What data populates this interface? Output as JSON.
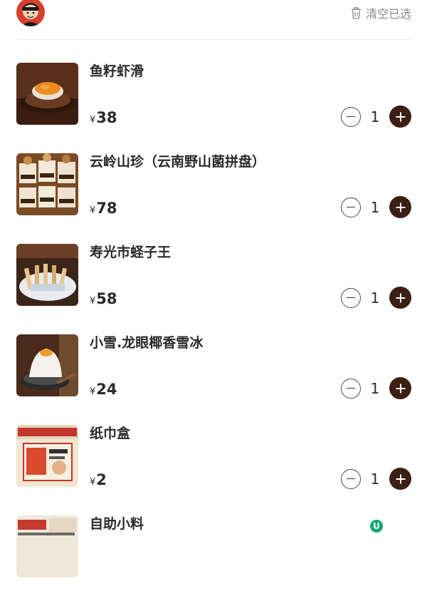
{
  "header": {
    "clear_label": "清空已选"
  },
  "items": [
    {
      "name": "鱼籽虾滑",
      "currency": "¥",
      "price": "38",
      "qty": "1"
    },
    {
      "name": "云岭山珍（云南野山菌拼盘）",
      "currency": "¥",
      "price": "78",
      "qty": "1"
    },
    {
      "name": "寿光市蛏子王",
      "currency": "¥",
      "price": "58",
      "qty": "1"
    },
    {
      "name": "小雪.龙眼椰香雪冰",
      "currency": "¥",
      "price": "24",
      "qty": "1"
    },
    {
      "name": "纸巾盒",
      "currency": "¥",
      "price": "2",
      "qty": "1"
    },
    {
      "name": "自助小料",
      "badge": "U"
    }
  ],
  "colors": {
    "accent": "#3b1f12",
    "avatar": "#d6402c",
    "badge": "#12a574"
  },
  "icons": {
    "clear": "trash-icon",
    "avatar": "avatar-icon",
    "minus": "minus-circle-icon",
    "plus": "plus-circle-icon"
  }
}
